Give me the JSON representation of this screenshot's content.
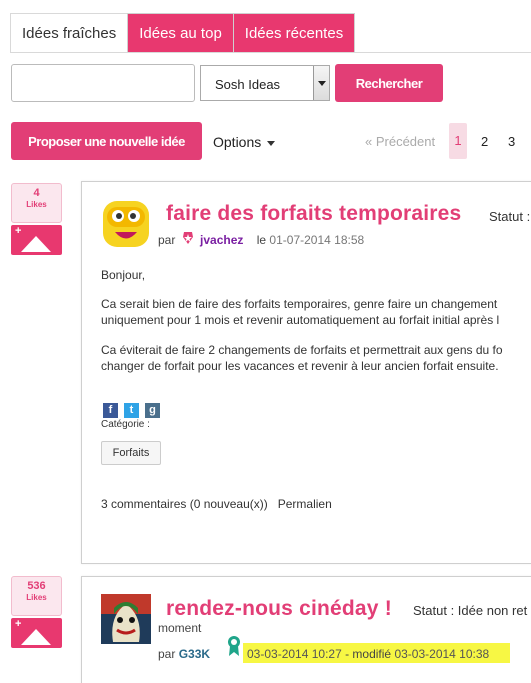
{
  "tabs": [
    {
      "label": "Idées fraîches",
      "active": true
    },
    {
      "label": "Idées au top",
      "active": false
    },
    {
      "label": "Idées récentes",
      "active": false
    }
  ],
  "search": {
    "value": "",
    "placeholder": "",
    "button": "Rechercher"
  },
  "community_select": {
    "selected": "Sosh Ideas"
  },
  "toolbar": {
    "propose": "Proposer une nouvelle idée",
    "options": "Options"
  },
  "pagination": {
    "prev": "« Précédent",
    "current": "1",
    "pages": [
      "2",
      "3"
    ]
  },
  "ideas": [
    {
      "likes": "4",
      "likes_label": "Likes",
      "title": "faire des forfaits temporaires",
      "status": "Statut :",
      "by": "par",
      "author": "jvachez",
      "date_prefix": "le",
      "date": "01-07-2014 18:58",
      "body": [
        "Bonjour,",
        "Ca serait bien de faire des forfaits temporaires, genre faire un changement",
        "uniquement pour 1 mois et revenir automatiquement au forfait initial après l",
        "Ca éviterait de faire 2 changements de forfaits et permettrait aux gens du fo",
        "changer de forfait pour les vacances et revenir à leur ancien forfait ensuite."
      ],
      "category_label": "Catégorie :",
      "category": "Forfaits",
      "comments": "3 commentaires (0 nouveau(x))",
      "permalink": "Permalien"
    },
    {
      "likes": "536",
      "likes_label": "Likes",
      "title": "rendez-nous cinéday !",
      "status": "Statut : Idée non ret",
      "status_cont": "moment",
      "by": "par",
      "author": "G33K",
      "date": "03-03-2014 10:27",
      "modified_label": "- modifié",
      "modified": "03-03-2014 10:38"
    }
  ],
  "colors": {
    "accent": "#e23e76",
    "like_bg": "#fbe7ee",
    "author": "#7a1fa2",
    "highlight": "#f7f744"
  }
}
